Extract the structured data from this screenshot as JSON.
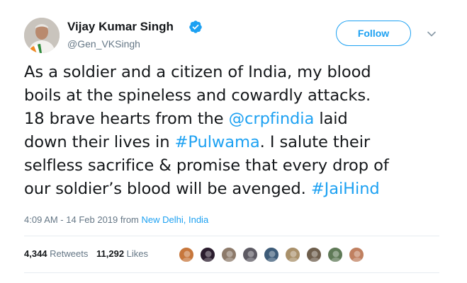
{
  "author": {
    "name": "Vijay Kumar Singh",
    "handle": "@Gen_VKSingh",
    "verified": true
  },
  "follow_button": {
    "label": "Follow"
  },
  "menu": {
    "icon": "chevron-down-icon"
  },
  "tweet": {
    "lines": [
      [
        {
          "text": "As a soldier and a citizen of India, my blood"
        }
      ],
      [
        {
          "text": "boils at the spineless and cowardly attacks."
        }
      ],
      [
        {
          "text": "18 brave hearts from the "
        },
        {
          "text": "@crpfindia",
          "link": true
        },
        {
          "text": " laid"
        }
      ],
      [
        {
          "text": "down their lives in "
        },
        {
          "text": "#Pulwama",
          "link": true
        },
        {
          "text": ". I salute their"
        }
      ],
      [
        {
          "text": "selfless sacrifice & promise that every drop of"
        }
      ],
      [
        {
          "text": "our soldier’s blood will be avenged. "
        },
        {
          "text": "#JaiHind",
          "link": true
        }
      ]
    ]
  },
  "meta": {
    "timestamp": "4:09 AM - 14 Feb 2019",
    "from_label": "from",
    "location": "New Delhi, India"
  },
  "stats": {
    "retweets_count": "4,344",
    "retweets_label": "Retweets",
    "likes_count": "11,292",
    "likes_label": "Likes"
  },
  "colors": {
    "link": "#1da1f2",
    "text": "#14171a",
    "secondary": "#657786",
    "divider": "#e6ecf0"
  },
  "likers": [
    {
      "name": "liker-avatar-1",
      "color": "#c7773c"
    },
    {
      "name": "liker-avatar-2",
      "color": "#2b1d2e"
    },
    {
      "name": "liker-avatar-3",
      "color": "#8d7a6a"
    },
    {
      "name": "liker-avatar-4",
      "color": "#5d5a63"
    },
    {
      "name": "liker-avatar-5",
      "color": "#3d5b78"
    },
    {
      "name": "liker-avatar-6",
      "color": "#a9906a"
    },
    {
      "name": "liker-avatar-7",
      "color": "#6e5e4c"
    },
    {
      "name": "liker-avatar-8",
      "color": "#5f7a57"
    },
    {
      "name": "liker-avatar-9",
      "color": "#c08060"
    }
  ]
}
